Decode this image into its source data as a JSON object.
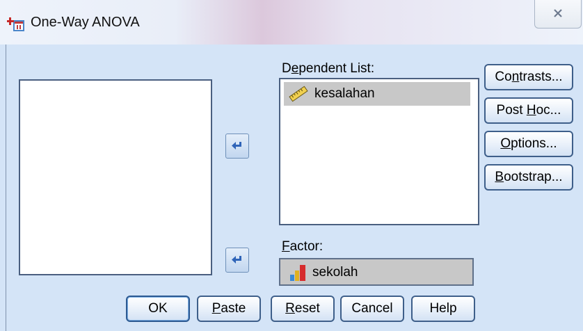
{
  "window": {
    "title": "One-Way ANOVA"
  },
  "dependent_list": {
    "label_pre": "D",
    "label_u": "e",
    "label_post": "pendent List:",
    "items": [
      {
        "name": "kesalahan",
        "icon": "ruler-scale-icon"
      }
    ]
  },
  "factor": {
    "label_pre": "",
    "label_u": "F",
    "label_post": "actor:",
    "value": "sekolah",
    "icon": "bar-chart-nominal-icon"
  },
  "side_buttons": {
    "contrasts": {
      "pre": "Co",
      "u": "n",
      "post": "trasts..."
    },
    "post_hoc": {
      "pre": "Post ",
      "u": "H",
      "post": "oc..."
    },
    "options": {
      "pre": "",
      "u": "O",
      "post": "ptions..."
    },
    "bootstrap": {
      "pre": "",
      "u": "B",
      "post": "ootstrap..."
    }
  },
  "bottom_buttons": {
    "ok": "OK",
    "paste": {
      "pre": "",
      "u": "P",
      "post": "aste"
    },
    "reset": {
      "pre": "",
      "u": "R",
      "post": "eset"
    },
    "cancel": "Cancel",
    "help": "Help"
  }
}
